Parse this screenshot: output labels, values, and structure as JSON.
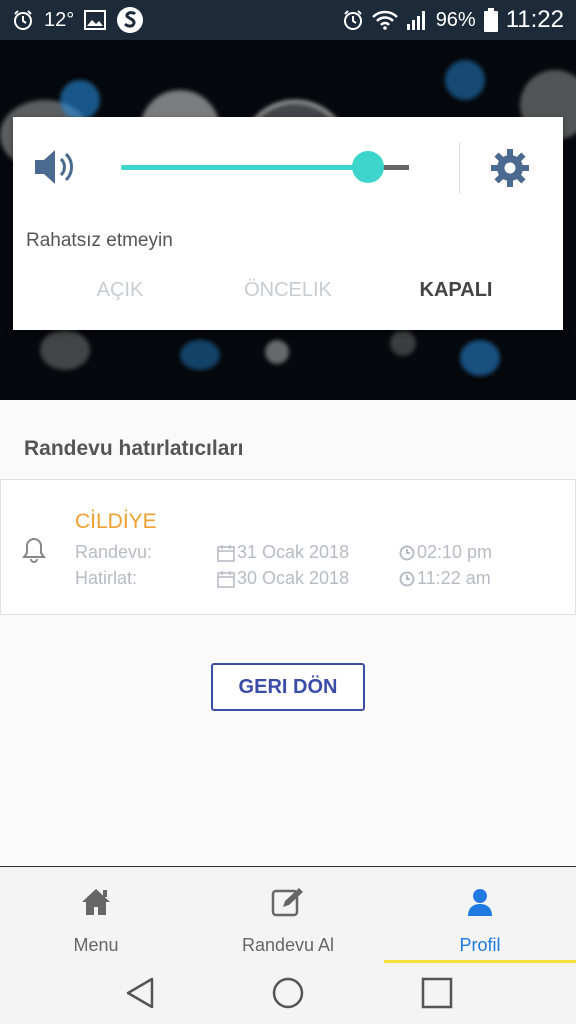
{
  "status_bar": {
    "temperature": "12°",
    "battery": "96%",
    "time": "11:22",
    "icons": [
      "alarm-icon",
      "image-icon",
      "s-app-icon",
      "alarm-icon",
      "wifi-icon",
      "signal-icon",
      "battery-icon"
    ]
  },
  "volume_panel": {
    "level": 0.87,
    "dnd_title": "Rahatsız etmeyin",
    "options": [
      "AÇIK",
      "ÖNCELIK",
      "KAPALI"
    ],
    "selected": "KAPALI",
    "accent": "#3dd4cc"
  },
  "reminders": {
    "section_title": "Randevu hatırlatıcıları",
    "items": [
      {
        "title": "CİLDİYE",
        "rows": [
          {
            "label": "Randevu:",
            "date": "31 Ocak 2018",
            "time": "02:10 pm"
          },
          {
            "label": "Hatirlat:",
            "date": "30 Ocak 2018",
            "time": "11:22 am"
          }
        ]
      }
    ]
  },
  "back_button": "GERI DÖN",
  "bottom_nav": {
    "items": [
      {
        "label": "Menu",
        "icon": "home-icon"
      },
      {
        "label": "Randevu Al",
        "icon": "edit-icon"
      },
      {
        "label": "Profil",
        "icon": "user-icon"
      }
    ],
    "active": "Profil",
    "active_color": "#1e7ae0",
    "underline_color": "#f4e23b"
  },
  "system_nav": [
    "back-icon",
    "home-circle-icon",
    "recents-icon"
  ]
}
